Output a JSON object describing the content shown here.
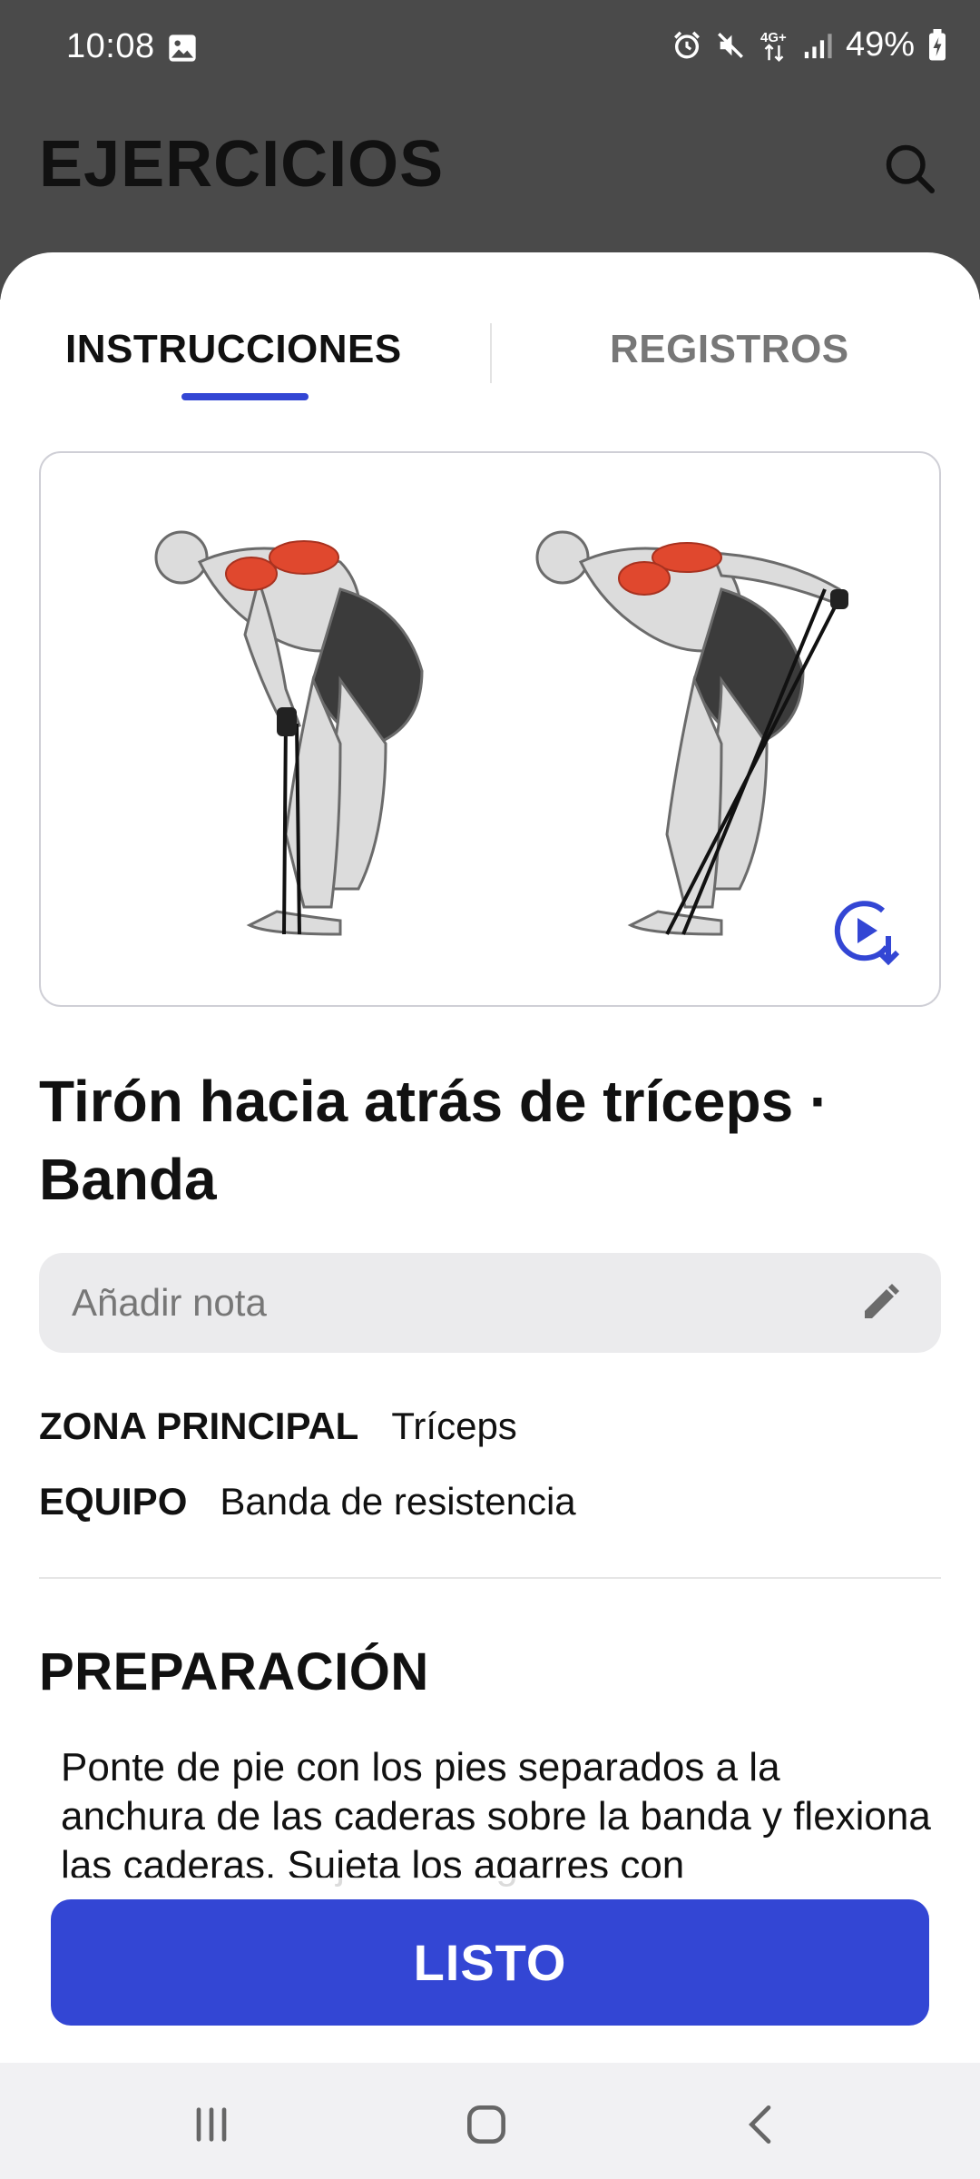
{
  "status_bar": {
    "time": "10:08",
    "battery": "49%",
    "icons": [
      "gallery-icon",
      "alarm-icon",
      "mute-icon",
      "4g-icon",
      "signal-icon",
      "battery-icon"
    ]
  },
  "app_bar": {
    "title": "EJERCICIOS",
    "search_icon": "search-icon"
  },
  "tabs": [
    {
      "label": "INSTRUCCIONES",
      "active": true
    },
    {
      "label": "REGISTROS",
      "active": false
    }
  ],
  "exercise": {
    "name": "Tirón hacia atrás de tríceps · Banda",
    "note_placeholder": "Añadir nota",
    "meta": [
      {
        "key": "ZONA PRINCIPAL",
        "value": "Tríceps"
      },
      {
        "key": "EQUIPO",
        "value": "Banda de resistencia"
      }
    ],
    "section_title": "PREPARACIÓN",
    "preparation": "Ponte de pie con los pies separados a la anchura de las caderas sobre la banda y flexiona las caderas. Sujeta los agarres con"
  },
  "done_button": "LISTO",
  "colors": {
    "accent": "#3346d4",
    "header": "#4a4a4a",
    "muscle_highlight": "#e0482e"
  },
  "nav": [
    "recents-icon",
    "home-icon",
    "back-icon"
  ]
}
